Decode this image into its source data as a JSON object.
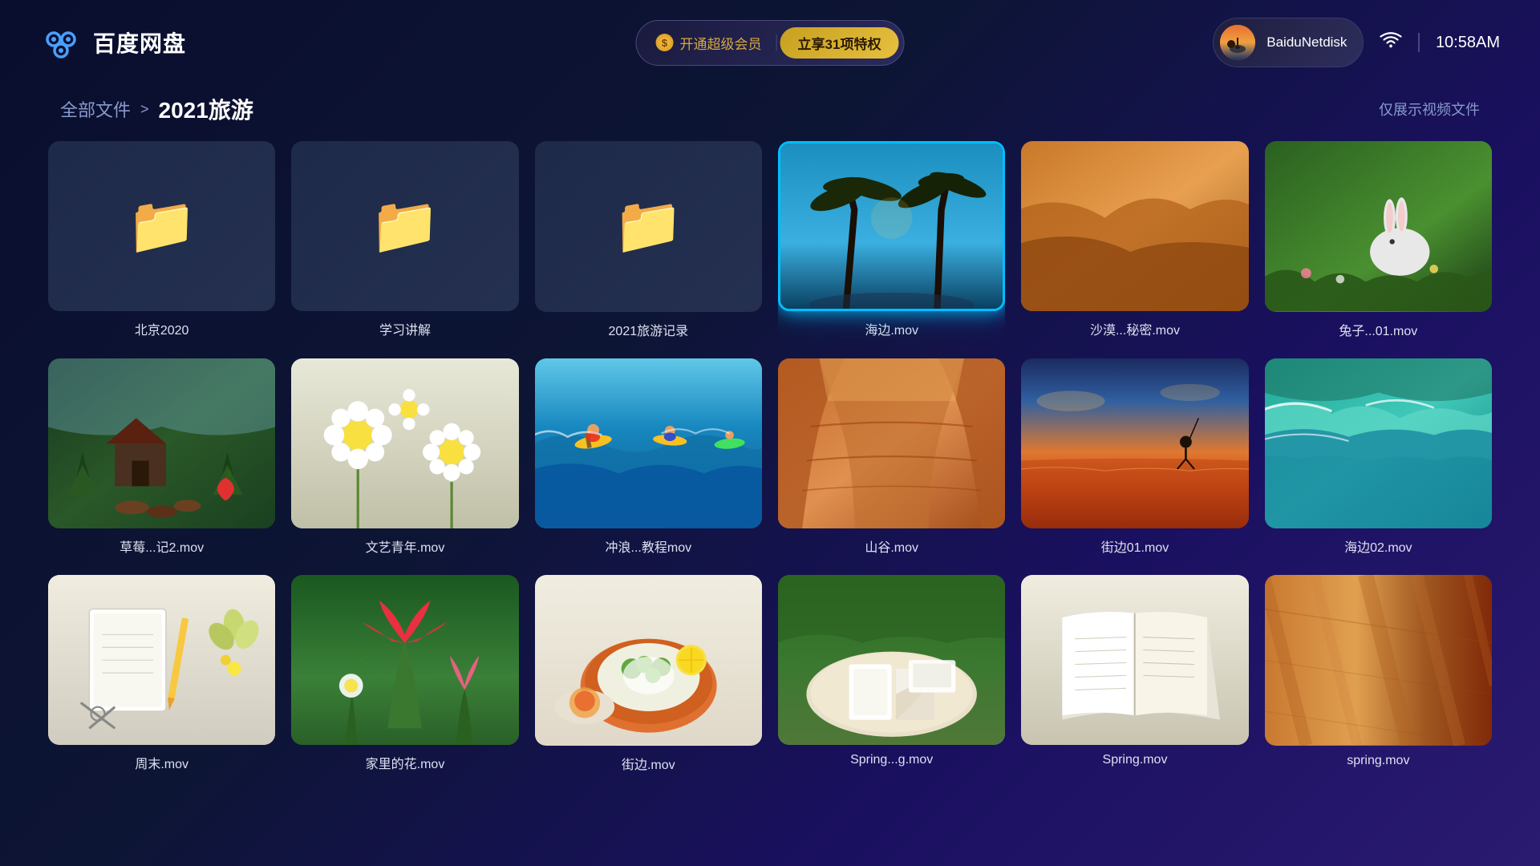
{
  "app": {
    "logo_text": "百度网盘",
    "time": "10:58AM"
  },
  "header": {
    "vip_left": "开通超级会员",
    "vip_right": "立享31项特权",
    "user_name": "BaiduNetdisk"
  },
  "breadcrumb": {
    "all": "全部文件",
    "arrow": ">",
    "current": "2021旅游",
    "filter": "仅展示视频文件"
  },
  "grid": {
    "items": [
      {
        "type": "folder",
        "name": "北京2020",
        "row": 0
      },
      {
        "type": "folder",
        "name": "学习讲解",
        "row": 0
      },
      {
        "type": "folder",
        "name": "2021旅游记录",
        "row": 0
      },
      {
        "type": "video",
        "name": "海边.mov",
        "scene": "beach",
        "selected": true,
        "row": 0
      },
      {
        "type": "video",
        "name": "沙漠...秘密.mov",
        "scene": "desert",
        "selected": false,
        "row": 0
      },
      {
        "type": "video",
        "name": "兔子...01.mov",
        "scene": "rabbit",
        "selected": false,
        "row": 0
      },
      {
        "type": "video",
        "name": "草莓...记2.mov",
        "scene": "forest",
        "selected": false,
        "row": 1
      },
      {
        "type": "video",
        "name": "文艺青年.mov",
        "scene": "flowers",
        "selected": false,
        "row": 1
      },
      {
        "type": "video",
        "name": "冲浪...教程mov",
        "scene": "surf",
        "selected": false,
        "row": 1
      },
      {
        "type": "video",
        "name": "山谷.mov",
        "scene": "canyon",
        "selected": false,
        "row": 1
      },
      {
        "type": "video",
        "name": "街边01.mov",
        "scene": "sunset",
        "selected": false,
        "row": 1
      },
      {
        "type": "video",
        "name": "海边02.mov",
        "scene": "ocean",
        "selected": false,
        "row": 1
      },
      {
        "type": "video",
        "name": "周末.mov",
        "scene": "desk",
        "selected": false,
        "row": 2
      },
      {
        "type": "video",
        "name": "家里的花.mov",
        "scene": "tulip",
        "selected": false,
        "row": 2
      },
      {
        "type": "video",
        "name": "街边.mov",
        "scene": "food",
        "selected": false,
        "row": 2
      },
      {
        "type": "video",
        "name": "Spring...g.mov",
        "scene": "picnic",
        "selected": false,
        "row": 2
      },
      {
        "type": "video",
        "name": "Spring.mov",
        "scene": "book",
        "selected": false,
        "row": 2
      },
      {
        "type": "video",
        "name": "spring.mov",
        "scene": "wood",
        "selected": false,
        "row": 2
      }
    ]
  }
}
